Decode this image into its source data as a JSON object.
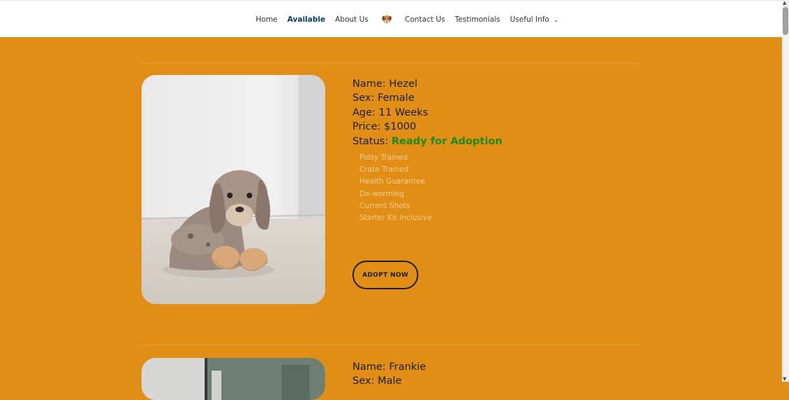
{
  "nav": {
    "items": [
      "Home",
      "Available",
      "About Us",
      "Contact Us",
      "Testimonials",
      "Useful Info"
    ],
    "active": "Available",
    "logo_icon": "puppy-face-logo-icon",
    "dropdown_icon": "chevron-down-icon"
  },
  "listings": [
    {
      "name_line": "Name: Hezel",
      "sex_line": "Sex: Female",
      "age_line": "Age: 11 Weeks",
      "price_line": "Price: $1000",
      "status_label": "Status:",
      "status_value": "Ready for Adoption",
      "features": [
        "Potty Trained",
        "Crate Trained",
        "Health Guarantee",
        "De-worming",
        "Current Shots",
        "Starter Kit Inclusive"
      ],
      "button_label": "ADOPT NOW"
    },
    {
      "name_line": "Name: Frankie",
      "sex_line": "Sex: Male"
    }
  ],
  "colors": {
    "page_background": "#e08e16",
    "header_background": "#ffffff",
    "active_nav": "#0b3c6a",
    "status_ready": "#1f8a0d",
    "feature_text": "#f7cc8d"
  }
}
